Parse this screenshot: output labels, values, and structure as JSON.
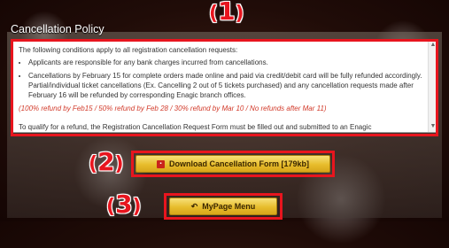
{
  "policy": {
    "title": "Cancellation Policy",
    "intro": "The following conditions apply to all registration cancellation requests:",
    "bullets": [
      "Applicants are responsible for any bank charges incurred from cancellations.",
      "Cancellations by February 15 for complete orders made online and paid via credit/debit card will be fully refunded accordingly. Partial/individual ticket cancellations (Ex. Cancelling 2 out of 5 tickets purchased) and any cancellation requests made after February 16 will be refunded by corresponding Enagic branch offices."
    ],
    "note": "(100% refund by Feb15 / 50% refund by Feb 28 / 30% refund by Mar 10 / No refunds after Mar 11)",
    "cutoff_text": "To qualify for a refund, the Registration Cancellation Request Form must be filled out and submitted to an Enagic"
  },
  "callouts": {
    "one": {
      "open": "(",
      "digit": "1",
      "close": ")"
    },
    "two": {
      "open": "(",
      "digit": "2",
      "close": ")"
    },
    "three": {
      "open": "(",
      "digit": "3",
      "close": ")"
    }
  },
  "buttons": {
    "download_label": "Download Cancellation Form [179kb]",
    "mypage_label": "MyPage Menu"
  },
  "icons": {
    "download": "pdf-icon",
    "mypage": "back-arrow-icon",
    "scroll_up": "chevron-up-icon",
    "scroll_down": "chevron-down-icon"
  },
  "colors": {
    "callout": "#e8151e",
    "button": "#e7bd2c",
    "note": "#d23a2a"
  }
}
